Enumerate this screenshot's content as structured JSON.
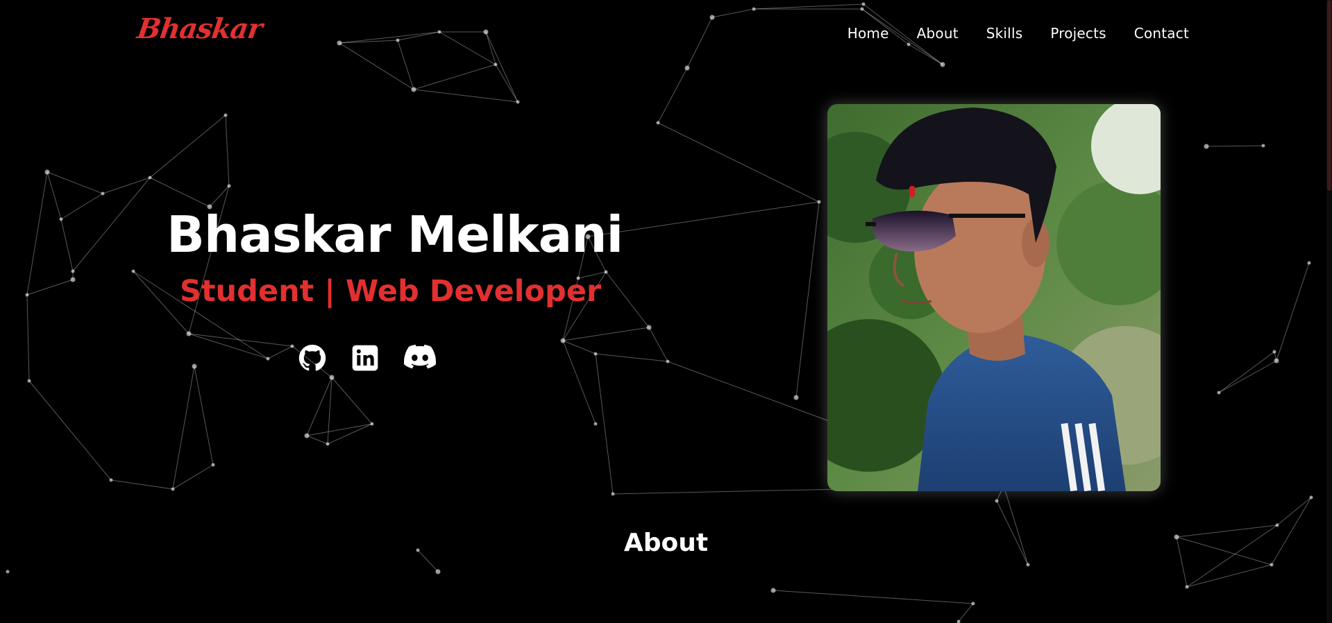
{
  "brand": {
    "logo_text": "Bhaskar",
    "accent": "#e23030"
  },
  "nav": {
    "items": [
      {
        "label": "Home"
      },
      {
        "label": "About"
      },
      {
        "label": "Skills"
      },
      {
        "label": "Projects"
      },
      {
        "label": "Contact"
      }
    ]
  },
  "hero": {
    "name": "Bhaskar Melkani",
    "role": "Student | Web Developer",
    "socials": [
      {
        "icon": "github-icon"
      },
      {
        "icon": "linkedin-icon"
      },
      {
        "icon": "discord-icon"
      }
    ],
    "photo": {
      "subject": "profile-photo"
    }
  },
  "about": {
    "title": "About"
  },
  "colors": {
    "background": "#000000",
    "text": "#ffffff",
    "accent": "#e23030"
  }
}
